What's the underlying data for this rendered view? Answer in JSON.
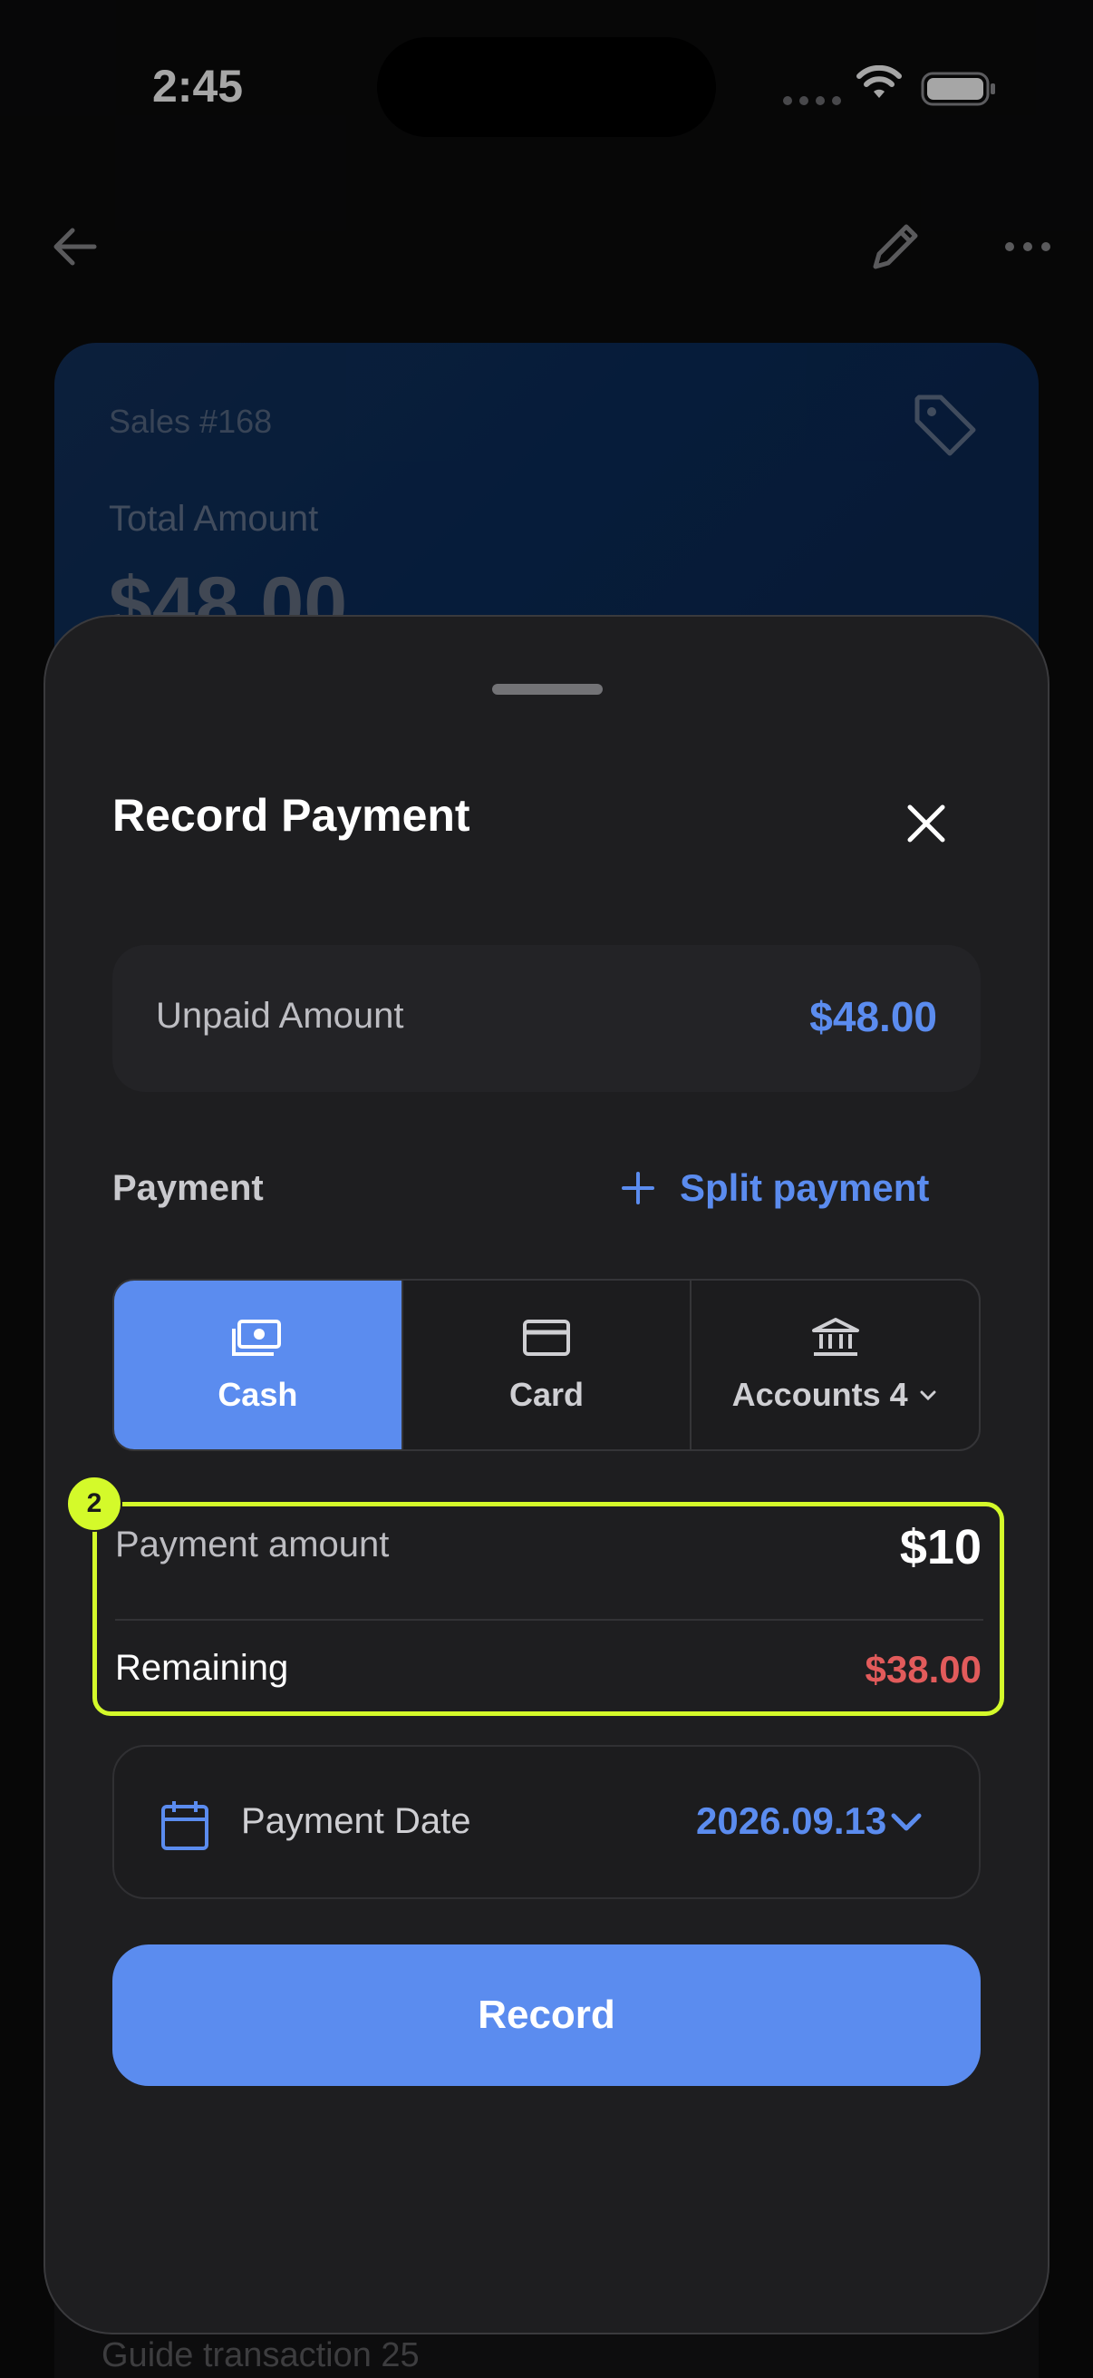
{
  "status_bar": {
    "time": "2:45"
  },
  "background": {
    "sales_card": {
      "title": "Sales #168",
      "total_label": "Total Amount",
      "total_value": "$48.00"
    },
    "list_item_text": "Guide transaction 25"
  },
  "sheet": {
    "title": "Record Payment",
    "unpaid": {
      "label": "Unpaid Amount",
      "value": "$48.00"
    },
    "payment_section": {
      "label": "Payment",
      "split_label": "Split payment"
    },
    "methods": [
      {
        "label": "Cash",
        "icon": "cash-icon",
        "active": true
      },
      {
        "label": "Card",
        "icon": "card-icon",
        "active": false
      },
      {
        "label": "Accounts 4",
        "icon": "bank-icon",
        "active": false
      }
    ],
    "amount": {
      "badge": "2",
      "label": "Payment amount",
      "value": "$10",
      "remaining_label": "Remaining",
      "remaining_value": "$38.00"
    },
    "date": {
      "label": "Payment Date",
      "value": "2026.09.13"
    },
    "record_label": "Record"
  },
  "colors": {
    "accent": "#5b8cef",
    "negative": "#e25b5b",
    "highlight": "#d4fa2a",
    "sheet_bg": "#1e1e20"
  }
}
